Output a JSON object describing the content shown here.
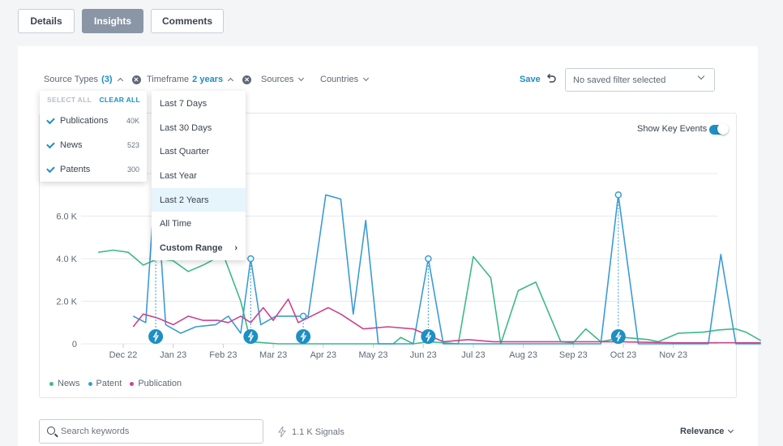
{
  "tabs": [
    "Details",
    "Insights",
    "Comments"
  ],
  "filters": {
    "source_types_label": "Source Types",
    "source_types_count": "(3)",
    "timeframe_label": "Timeframe",
    "timeframe_value": "2 years",
    "sources_label": "Sources",
    "countries_label": "Countries"
  },
  "save_label": "Save",
  "saved_filter_placeholder": "No saved filter selected",
  "show_key_events_label": "Show Key Events",
  "source_dropdown": {
    "select_all": "SELECT ALL",
    "clear_all": "CLEAR ALL",
    "items": [
      {
        "label": "Publications",
        "count": "40K"
      },
      {
        "label": "News",
        "count": "523"
      },
      {
        "label": "Patents",
        "count": "300"
      }
    ]
  },
  "timeframe_dropdown": {
    "options": [
      "Last 7 Days",
      "Last 30 Days",
      "Last Quarter",
      "Last Year",
      "Last 2 Years",
      "All Time",
      "Custom Range"
    ],
    "selected": "Last 2 Years"
  },
  "chart_data": {
    "type": "line",
    "y_ticks": [
      "0",
      "2.0 K",
      "4.0 K",
      "6.0 K"
    ],
    "ylim": [
      0,
      8000
    ],
    "x_ticks": [
      "Dec 22",
      "Jan 23",
      "Feb 23",
      "Mar 23",
      "Apr 23",
      "May 23",
      "Jun 23",
      "Jul 23",
      "Aug 23",
      "Sep 23",
      "Oct 23",
      "Nov 23"
    ],
    "series": [
      {
        "name": "News",
        "color": "#3cb98a",
        "points": [
          [
            0,
            4300
          ],
          [
            0.3,
            4400
          ],
          [
            0.6,
            4300
          ],
          [
            0.9,
            3700
          ],
          [
            1.2,
            4000
          ],
          [
            1.5,
            3900
          ],
          [
            1.8,
            3400
          ],
          [
            2.1,
            3700
          ],
          [
            2.5,
            4200
          ],
          [
            2.85,
            2000
          ],
          [
            3.05,
            100
          ],
          [
            3.6,
            0
          ],
          [
            5.4,
            0
          ],
          [
            5.9,
            0
          ],
          [
            6.05,
            300
          ],
          [
            6.3,
            0
          ],
          [
            6.6,
            100
          ],
          [
            7.2,
            0
          ],
          [
            7.5,
            4100
          ],
          [
            7.85,
            3100
          ],
          [
            8.05,
            0
          ],
          [
            8.4,
            2500
          ],
          [
            8.75,
            2900
          ],
          [
            9.25,
            100
          ],
          [
            9.5,
            50
          ],
          [
            9.75,
            700
          ],
          [
            10.05,
            100
          ],
          [
            10.5,
            300
          ],
          [
            11.0,
            200
          ],
          [
            11.2,
            100
          ],
          [
            11.6,
            500
          ],
          [
            12.1,
            550
          ],
          [
            12.4,
            650
          ],
          [
            12.75,
            700
          ],
          [
            12.95,
            550
          ],
          [
            13.25,
            150
          ]
        ]
      },
      {
        "name": "Patent",
        "color": "#3a9bd6",
        "points": [
          [
            0.7,
            1300
          ],
          [
            0.95,
            1000
          ],
          [
            1.15,
            8000
          ],
          [
            1.35,
            900
          ],
          [
            1.65,
            500
          ],
          [
            1.95,
            800
          ],
          [
            2.35,
            900
          ],
          [
            2.6,
            1300
          ],
          [
            2.85,
            500
          ],
          [
            3.05,
            4000
          ],
          [
            3.25,
            900
          ],
          [
            3.55,
            1300
          ],
          [
            4.2,
            1300
          ],
          [
            4.55,
            7000
          ],
          [
            4.85,
            6800
          ],
          [
            5.1,
            1400
          ],
          [
            5.35,
            5800
          ],
          [
            5.6,
            0
          ],
          [
            6.3,
            0
          ],
          [
            6.6,
            4000
          ],
          [
            6.9,
            0
          ],
          [
            10.05,
            0
          ],
          [
            10.4,
            7000
          ],
          [
            10.8,
            0
          ],
          [
            12.2,
            0
          ],
          [
            12.45,
            4200
          ],
          [
            12.75,
            0
          ],
          [
            13.25,
            0
          ]
        ]
      },
      {
        "name": "Publication",
        "color": "#c9448e",
        "points": [
          [
            0.7,
            800
          ],
          [
            0.9,
            1400
          ],
          [
            1.2,
            1200
          ],
          [
            1.5,
            900
          ],
          [
            1.8,
            1300
          ],
          [
            2.1,
            1100
          ],
          [
            2.4,
            1100
          ],
          [
            2.6,
            1000
          ],
          [
            2.85,
            1300
          ],
          [
            3.05,
            1000
          ],
          [
            3.3,
            1700
          ],
          [
            3.5,
            1100
          ],
          [
            3.8,
            2100
          ],
          [
            4.0,
            1000
          ],
          [
            4.6,
            1700
          ],
          [
            4.85,
            1400
          ],
          [
            5.3,
            700
          ],
          [
            5.8,
            800
          ],
          [
            6.3,
            700
          ],
          [
            6.6,
            400
          ],
          [
            6.9,
            100
          ],
          [
            7.4,
            200
          ],
          [
            7.9,
            100
          ],
          [
            8.4,
            100
          ],
          [
            10.4,
            100
          ],
          [
            11.5,
            50
          ],
          [
            12.3,
            50
          ],
          [
            13.25,
            50
          ]
        ]
      }
    ],
    "markers": [
      {
        "x": 1.15,
        "y": 8000
      },
      {
        "x": 3.05,
        "y": 4000
      },
      {
        "x": 4.1,
        "y": 1300
      },
      {
        "x": 6.6,
        "y": 4000
      },
      {
        "x": 10.4,
        "y": 7000
      }
    ],
    "legend": [
      "News",
      "Patent",
      "Publication"
    ]
  },
  "search_placeholder": "Search keywords",
  "signals_label": "1.1 K Signals",
  "sort_label": "Relevance"
}
